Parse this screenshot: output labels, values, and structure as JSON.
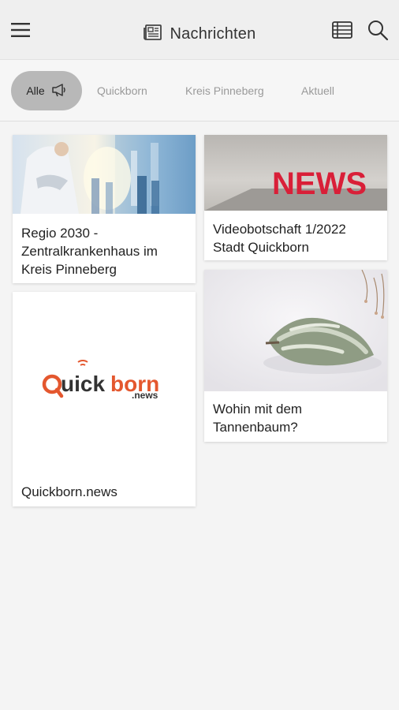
{
  "header": {
    "title": "Nachrichten",
    "icons": {
      "menu": "hamburger-menu-icon",
      "title": "newspaper-icon",
      "view": "list-view-icon",
      "search": "search-icon"
    }
  },
  "filters": {
    "active_label": "Alle",
    "active_icon": "megaphone-icon",
    "items": [
      {
        "label": "Quickborn"
      },
      {
        "label": "Kreis Pinneberg"
      },
      {
        "label": "Aktuell"
      }
    ]
  },
  "articles": [
    {
      "title": "Regio 2030 - Zentralkrankenhaus im Kreis Pinneberg",
      "image": "hospital-doctors-photo"
    },
    {
      "title": "Videobotschaft 1/2022 Stadt Quickborn",
      "image": "news-sign-photo"
    },
    {
      "title": "Quickborn.news",
      "image": "quickborn-news-logo"
    },
    {
      "title": "Wohin mit dem Tannenbaum?",
      "image": "fir-tree-in-snow-photo"
    }
  ],
  "logo": {
    "word_dark": "Quick",
    "word_orange": "born",
    "suffix": ".news",
    "colors": {
      "dark": "#333333",
      "orange": "#e4572e"
    }
  },
  "colors": {
    "appbar": "#efefef",
    "background": "#f4f4f4",
    "chip_active": "#b8b8b8",
    "chip_text": "#9a9a9a",
    "news_red": "#d91f38"
  }
}
